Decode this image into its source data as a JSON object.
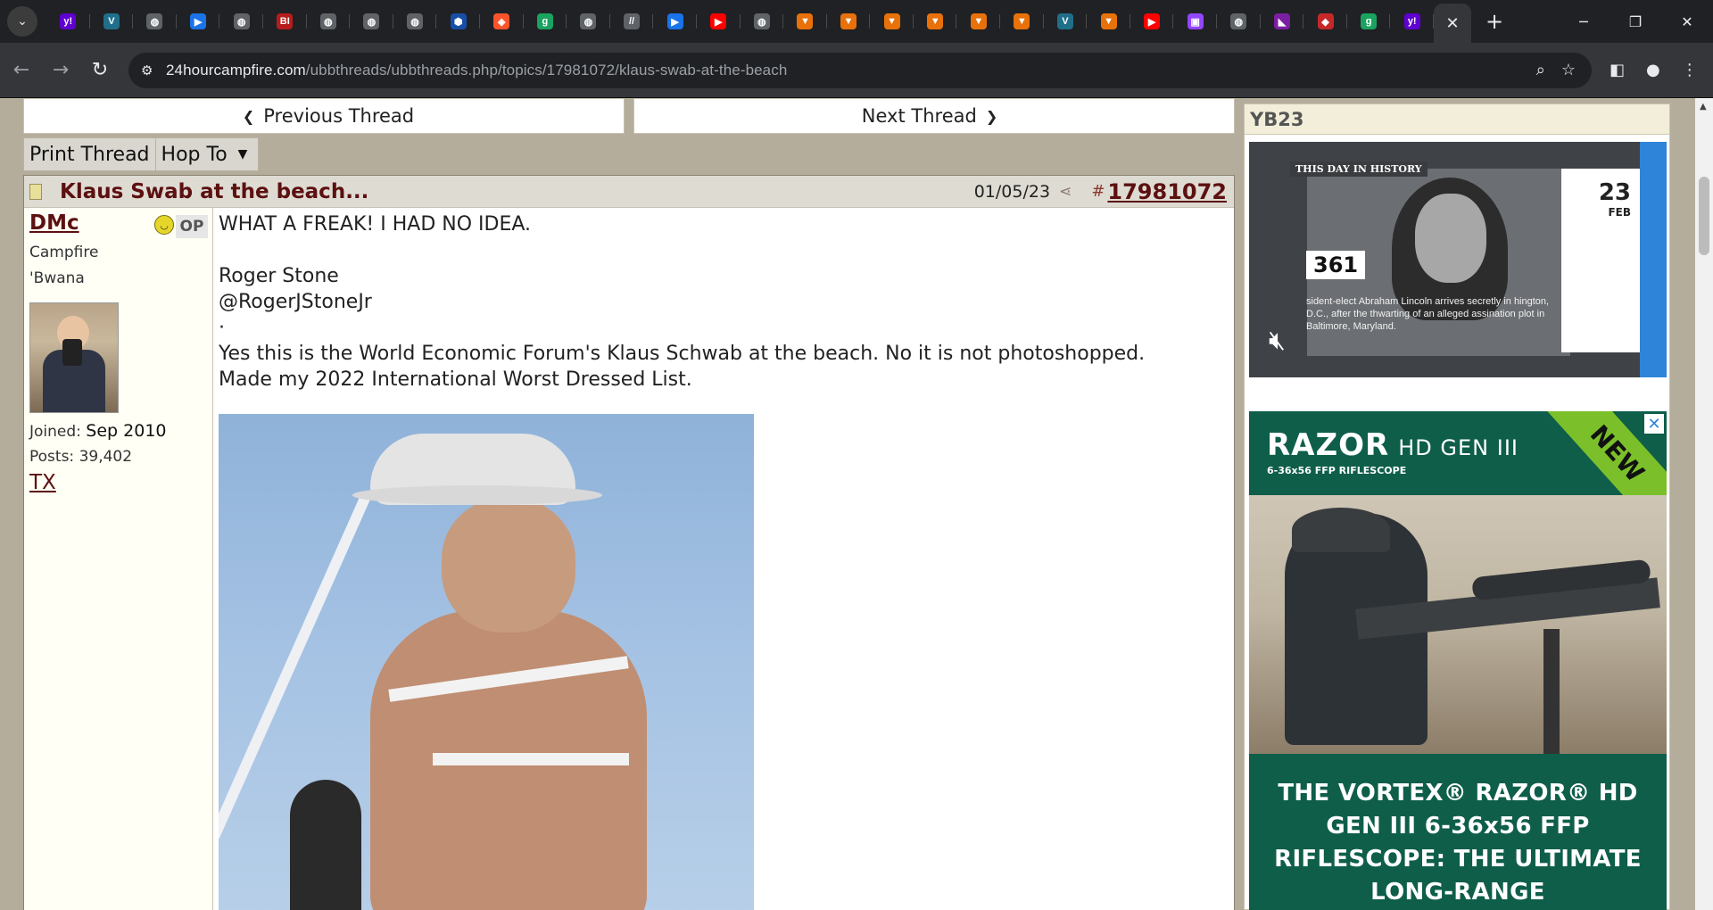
{
  "browser": {
    "tabs": [
      {
        "icon": "yahoo-icon",
        "glyph": "y!",
        "bg": "#6001d2"
      },
      {
        "icon": "shield-v-icon",
        "glyph": "V",
        "bg": "#1f6f8b"
      },
      {
        "icon": "globe-icon",
        "glyph": "◍",
        "bg": "#5f6368"
      },
      {
        "icon": "play-arrow-icon",
        "glyph": "▶",
        "bg": "#1a73e8"
      },
      {
        "icon": "globe-icon",
        "glyph": "◍",
        "bg": "#5f6368"
      },
      {
        "icon": "bi-icon",
        "glyph": "BI",
        "bg": "#b71c1c"
      },
      {
        "icon": "globe-icon",
        "glyph": "◍",
        "bg": "#5f6368"
      },
      {
        "icon": "globe-icon",
        "glyph": "◍",
        "bg": "#5f6368"
      },
      {
        "icon": "globe-icon",
        "glyph": "◍",
        "bg": "#5f6368"
      },
      {
        "icon": "hexagon-icon",
        "glyph": "⬢",
        "bg": "#174ea6"
      },
      {
        "icon": "brave-icon",
        "glyph": "◈",
        "bg": "#fb542b"
      },
      {
        "icon": "g-icon",
        "glyph": "g",
        "bg": "#1aa260"
      },
      {
        "icon": "globe-icon",
        "glyph": "◍",
        "bg": "#5f6368"
      },
      {
        "icon": "slash-icon",
        "glyph": "//",
        "bg": "#5f6368"
      },
      {
        "icon": "play-arrow-icon",
        "glyph": "▶",
        "bg": "#1a73e8"
      },
      {
        "icon": "youtube-icon",
        "glyph": "▶",
        "bg": "#ff0000"
      },
      {
        "icon": "globe-icon",
        "glyph": "◍",
        "bg": "#5f6368"
      },
      {
        "icon": "bookmark-icon",
        "glyph": "▼",
        "bg": "#e8710a"
      },
      {
        "icon": "bookmark-icon",
        "glyph": "▼",
        "bg": "#e8710a"
      },
      {
        "icon": "bookmark-icon",
        "glyph": "▼",
        "bg": "#e8710a"
      },
      {
        "icon": "bookmark-icon",
        "glyph": "▼",
        "bg": "#e8710a"
      },
      {
        "icon": "bookmark-icon",
        "glyph": "▼",
        "bg": "#e8710a"
      },
      {
        "icon": "bookmark-icon",
        "glyph": "▼",
        "bg": "#e8710a"
      },
      {
        "icon": "shield-v-icon",
        "glyph": "V",
        "bg": "#1f6f8b"
      },
      {
        "icon": "bookmark-icon",
        "glyph": "▼",
        "bg": "#e8710a"
      },
      {
        "icon": "youtube-icon",
        "glyph": "▶",
        "bg": "#ff0000"
      },
      {
        "icon": "twitch-icon",
        "glyph": "▣",
        "bg": "#9146ff"
      },
      {
        "icon": "globe-icon",
        "glyph": "◍",
        "bg": "#5f6368"
      },
      {
        "icon": "hat-icon",
        "glyph": "◣",
        "bg": "#7b1fa2"
      },
      {
        "icon": "red-shield-icon",
        "glyph": "◆",
        "bg": "#c62828"
      },
      {
        "icon": "g-icon",
        "glyph": "g",
        "bg": "#1aa260"
      },
      {
        "icon": "yahoo-icon",
        "glyph": "y!",
        "bg": "#6001d2"
      }
    ],
    "url_host": "24hourcampfire.com",
    "url_path": "/ubbthreads/ubbthreads.php/topics/17981072/klaus-swab-at-the-beach"
  },
  "thread_nav": {
    "previous": "Previous Thread",
    "next": "Next Thread"
  },
  "options": {
    "print": "Print Thread",
    "hop": "Hop To"
  },
  "post": {
    "title": "Klaus Swab at the beach...",
    "date": "01/05/23",
    "hash": "#",
    "number": "17981072",
    "user": {
      "name": "DMc",
      "badge": "OP",
      "title_line1": "Campfire",
      "title_line2": "'Bwana",
      "joined_label": "Joined:",
      "joined_value": "Sep 2010",
      "posts_label": "Posts:",
      "posts_value": "39,402",
      "location": "TX"
    },
    "lines": [
      "WHAT A FREAK! I HAD NO IDEA.",
      "",
      "Roger Stone",
      "@RogerJStoneJr",
      "·",
      "Yes this is the World Economic Forum's Klaus Schwab at the beach. No it is not photoshopped.",
      "Made my 2022 International Worst Dressed List."
    ]
  },
  "sidebar": {
    "header": "YB23",
    "history": {
      "label": "THIS DAY IN HISTORY",
      "year": "361",
      "day": "23",
      "month": "FEB",
      "caption": "sident-elect Abraham Lincoln arrives secretly in hington, D.C., after the thwarting of an alleged assination plot in Baltimore, Maryland."
    },
    "ad": {
      "brand": "RAZOR",
      "brand_sub": "HD GEN III",
      "spec": "6-36x56 FFP RIFLESCOPE",
      "badge": "NEW",
      "headline": "THE VORTEX® RAZOR® HD GEN III 6-36x56 FFP RIFLESCOPE: THE ULTIMATE LONG-RANGE"
    }
  }
}
